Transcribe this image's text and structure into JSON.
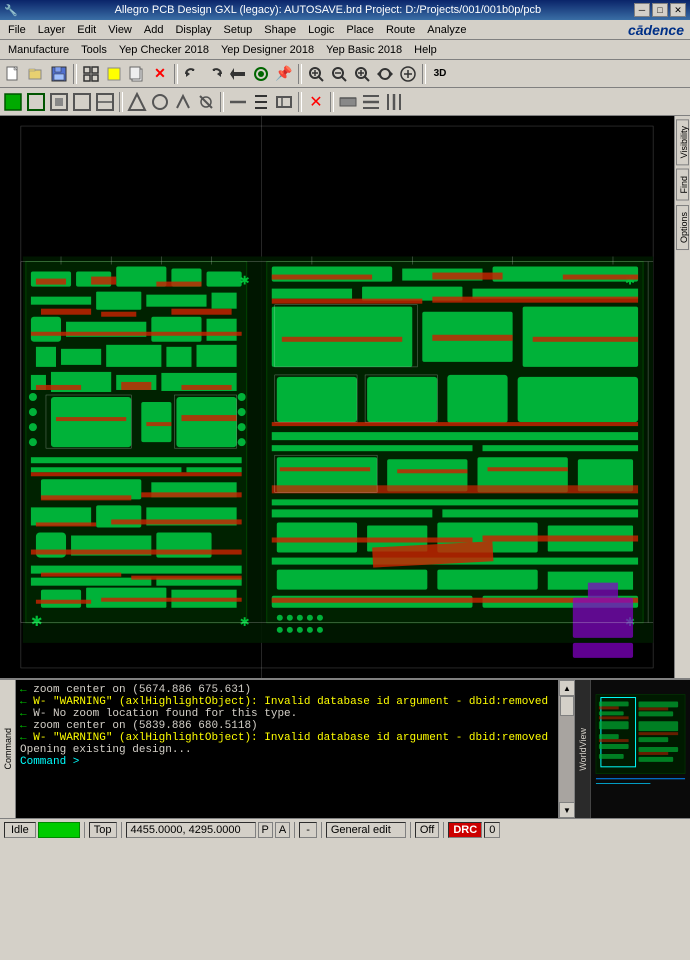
{
  "titleBar": {
    "title": "Allegro PCB Design GXL (legacy): AUTOSAVE.brd  Project: D:/Projects/001/001b0p/pcb",
    "minBtn": "─",
    "maxBtn": "□",
    "closeBtn": "✕"
  },
  "menuBar1": {
    "items": [
      "File",
      "Layer",
      "Edit",
      "View",
      "Add",
      "Display",
      "Setup",
      "Shape",
      "Logic",
      "Place",
      "Route",
      "Analyze"
    ]
  },
  "menuBar2": {
    "items": [
      "Manufacture",
      "Tools",
      "Yep Checker 2018",
      "Yep Designer 2018",
      "Yep Basic 2018",
      "Help"
    ]
  },
  "cadenceLogo": "cādence",
  "toolbar1": {
    "buttons": [
      {
        "icon": "📂",
        "name": "open"
      },
      {
        "icon": "💾",
        "name": "save"
      },
      {
        "icon": "🔒",
        "name": "lock"
      },
      {
        "icon": "✂",
        "name": "cut"
      },
      {
        "icon": "❌",
        "name": "delete"
      },
      {
        "icon": "↩",
        "name": "undo"
      },
      {
        "icon": "↪",
        "name": "redo"
      },
      {
        "icon": "⬆",
        "name": "up"
      },
      {
        "icon": "⬇",
        "name": "down"
      },
      {
        "icon": "⊙",
        "name": "center"
      },
      {
        "icon": "📌",
        "name": "pin"
      },
      {
        "icon": "🔍",
        "name": "zoom-fit"
      },
      {
        "icon": "🔎",
        "name": "zoom-in"
      },
      {
        "icon": "🔍",
        "name": "zoom-out"
      },
      {
        "icon": "🔄",
        "name": "refresh"
      },
      {
        "icon": "🌐",
        "name": "globe"
      },
      {
        "icon": "3D",
        "name": "3d"
      }
    ]
  },
  "toolbar2": {
    "buttons": [
      {
        "icon": "▣",
        "name": "tb2-1"
      },
      {
        "icon": "▣",
        "name": "tb2-2"
      },
      {
        "icon": "▣",
        "name": "tb2-3"
      },
      {
        "icon": "▣",
        "name": "tb2-4"
      },
      {
        "icon": "▣",
        "name": "tb2-5"
      },
      {
        "icon": "▣",
        "name": "tb2-6"
      },
      {
        "icon": "▣",
        "name": "tb2-7"
      },
      {
        "icon": "▣",
        "name": "tb2-8"
      },
      {
        "icon": "▣",
        "name": "tb2-9"
      },
      {
        "icon": "▣",
        "name": "tb2-10"
      },
      {
        "icon": "▣",
        "name": "tb2-11"
      },
      {
        "icon": "▣",
        "name": "tb2-12"
      },
      {
        "icon": "▣",
        "name": "tb2-13"
      },
      {
        "icon": "▣",
        "name": "tb2-14"
      },
      {
        "icon": "▣",
        "name": "tb2-15"
      },
      {
        "icon": "▣",
        "name": "tb2-16"
      },
      {
        "icon": "▣",
        "name": "tb2-17"
      },
      {
        "icon": "▣",
        "name": "tb2-18"
      },
      {
        "icon": "▣",
        "name": "tb2-19"
      },
      {
        "icon": "▣",
        "name": "tb2-20"
      }
    ]
  },
  "rightPanel": {
    "tabs": [
      "Visibility",
      "Find",
      "Options"
    ]
  },
  "console": {
    "lines": [
      {
        "type": "normal",
        "text": "zoom center on (5674.886 675.631)"
      },
      {
        "type": "warning",
        "text": "W- \"WARNING\" (axlHighlightObject): Invalid database id argument - dbid:removed"
      },
      {
        "type": "normal",
        "text": "W- No zoom location found for this type."
      },
      {
        "type": "normal",
        "text": "zoom center on (5839.886 680.5118)"
      },
      {
        "type": "warning",
        "text": "W- \"WARNING\" (axlHighlightObject): Invalid database id argument - dbid:removed"
      },
      {
        "type": "normal",
        "text": "Opening existing design..."
      },
      {
        "type": "prompt",
        "text": "Command >"
      }
    ],
    "label": "Command"
  },
  "worldview": {
    "label": "WorldView",
    "scrollUp": "▲",
    "scrollDown": "▼"
  },
  "statusBar": {
    "idle": "Idle",
    "mode": "Top",
    "coords": "4455.0000, 4295.0000",
    "coordSuffixes": [
      "P",
      "A"
    ],
    "separator": "-",
    "editMode": "General edit",
    "offLabel": "Off",
    "drc": "DRC",
    "count": "0"
  }
}
